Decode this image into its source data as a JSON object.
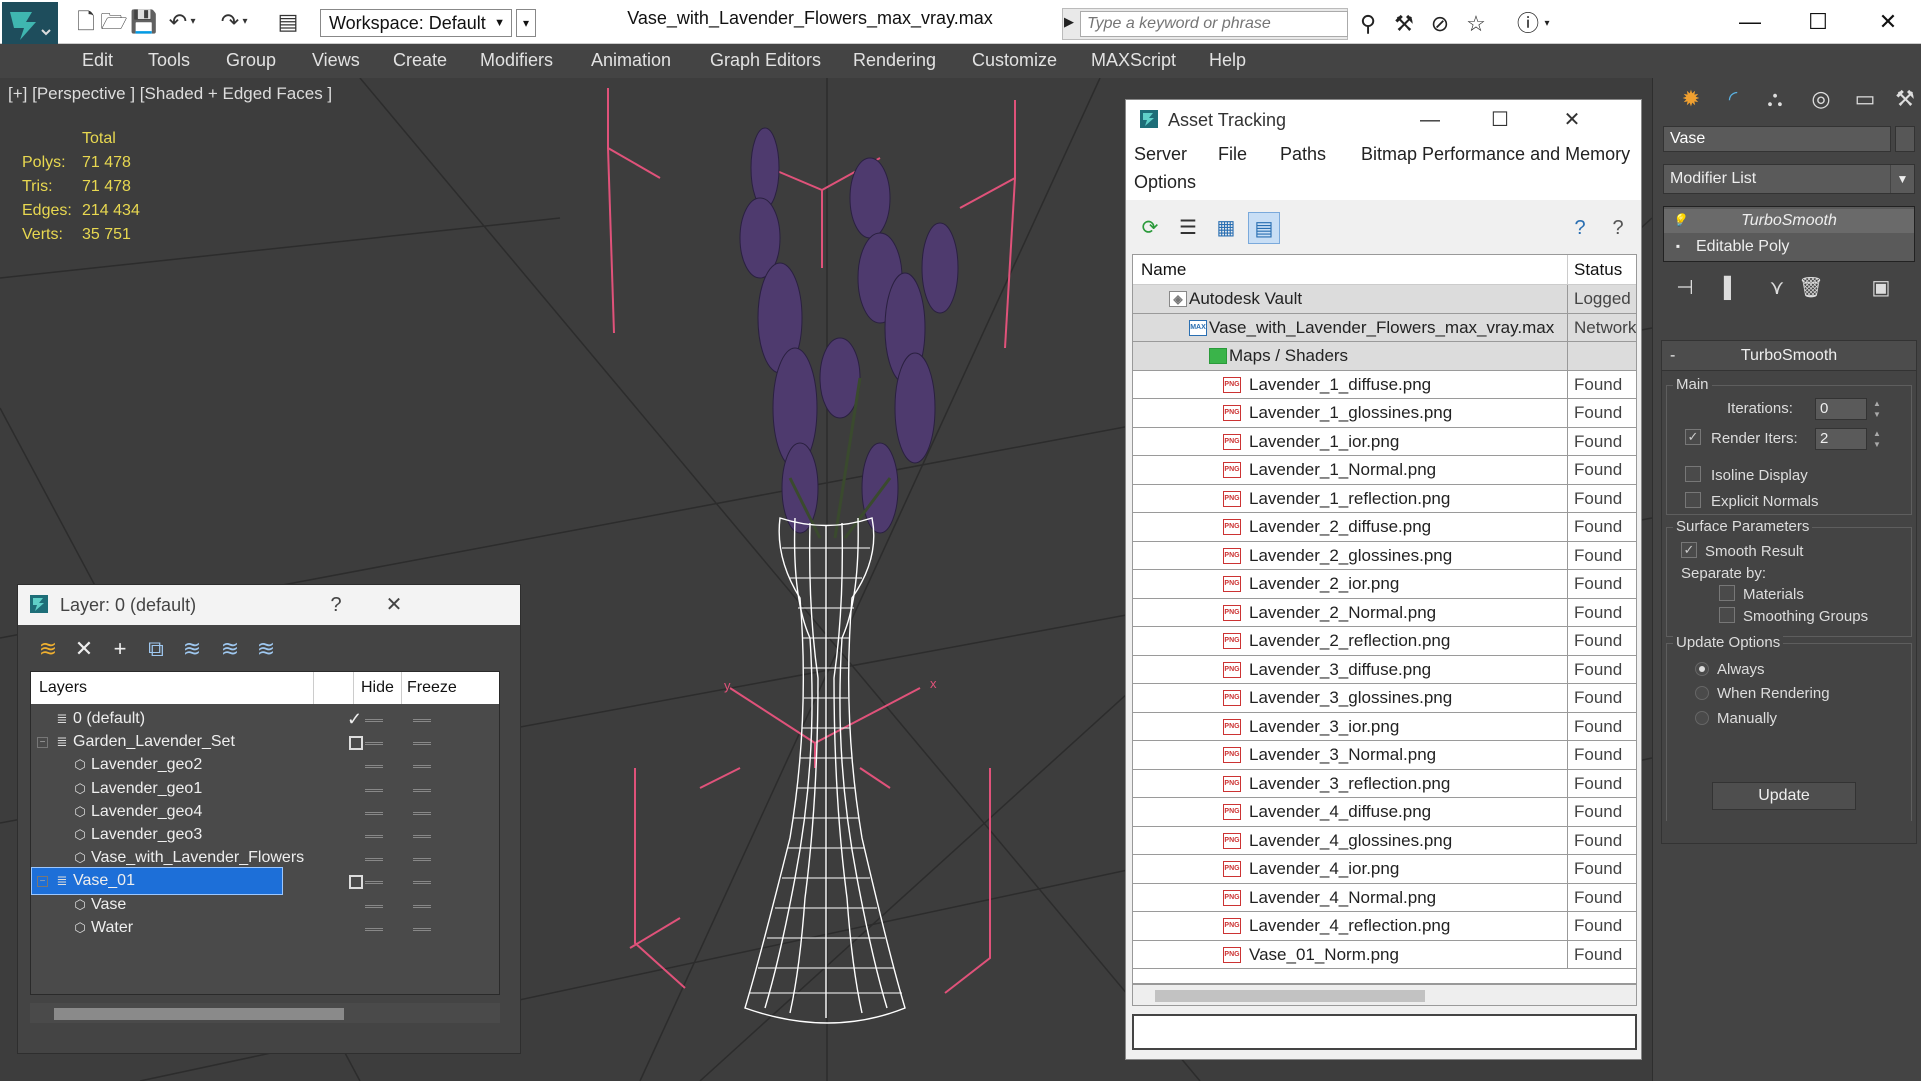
{
  "titlebar": {
    "workspace": "Workspace: Default",
    "file_title": "Vase_with_Lavender_Flowers_max_vray.max",
    "search_placeholder": "Type a keyword or phrase"
  },
  "menu": [
    "Edit",
    "Tools",
    "Group",
    "Views",
    "Create",
    "Modifiers",
    "Animation",
    "Graph Editors",
    "Rendering",
    "Customize",
    "MAXScript",
    "Help"
  ],
  "viewport": {
    "label": "[+] [Perspective ] [Shaded + Edged Faces ]",
    "stats_header": "Total",
    "stats": [
      {
        "label": "Polys:",
        "value": "71 478"
      },
      {
        "label": "Tris:",
        "value": "71 478"
      },
      {
        "label": "Edges:",
        "value": "214 434"
      },
      {
        "label": "Verts:",
        "value": "35 751"
      }
    ],
    "gizmo_x": "x",
    "gizmo_y": "y"
  },
  "command_panel": {
    "object_name": "Vase",
    "modifier_list": "Modifier List",
    "stack": [
      "TurboSmooth",
      "Editable Poly"
    ],
    "rollout_title": "TurboSmooth",
    "main_group": "Main",
    "iterations_label": "Iterations:",
    "iterations_value": "0",
    "render_iters_label": "Render Iters:",
    "render_iters_value": "2",
    "render_iters_checked": true,
    "isoline_display": "Isoline Display",
    "explicit_normals": "Explicit Normals",
    "surface_params_group": "Surface Parameters",
    "smooth_result": "Smooth Result",
    "smooth_result_checked": true,
    "separate_by": "Separate by:",
    "materials": "Materials",
    "smoothing_groups": "Smoothing Groups",
    "update_options_group": "Update Options",
    "update_options": [
      {
        "label": "Always",
        "selected": true
      },
      {
        "label": "When Rendering",
        "selected": false
      },
      {
        "label": "Manually",
        "selected": false
      }
    ],
    "update_button": "Update"
  },
  "asset_tracking": {
    "title": "Asset Tracking",
    "menu": [
      "Server",
      "File",
      "Paths",
      "Bitmap Performance and Memory",
      "Options"
    ],
    "columns": [
      "Name",
      "Status"
    ],
    "rows": [
      {
        "name": "Autodesk Vault",
        "status": "Logged",
        "level": 0,
        "icon": "vault"
      },
      {
        "name": "Vase_with_Lavender_Flowers_max_vray.max",
        "status": "Network",
        "level": 1,
        "icon": "max"
      },
      {
        "name": "Maps / Shaders",
        "status": "",
        "level": 2,
        "icon": "maps"
      },
      {
        "name": "Lavender_1_diffuse.png",
        "status": "Found",
        "level": 3,
        "icon": "png"
      },
      {
        "name": "Lavender_1_glossines.png",
        "status": "Found",
        "level": 3,
        "icon": "png"
      },
      {
        "name": "Lavender_1_ior.png",
        "status": "Found",
        "level": 3,
        "icon": "png"
      },
      {
        "name": "Lavender_1_Normal.png",
        "status": "Found",
        "level": 3,
        "icon": "png"
      },
      {
        "name": "Lavender_1_reflection.png",
        "status": "Found",
        "level": 3,
        "icon": "png"
      },
      {
        "name": "Lavender_2_diffuse.png",
        "status": "Found",
        "level": 3,
        "icon": "png"
      },
      {
        "name": "Lavender_2_glossines.png",
        "status": "Found",
        "level": 3,
        "icon": "png"
      },
      {
        "name": "Lavender_2_ior.png",
        "status": "Found",
        "level": 3,
        "icon": "png"
      },
      {
        "name": "Lavender_2_Normal.png",
        "status": "Found",
        "level": 3,
        "icon": "png"
      },
      {
        "name": "Lavender_2_reflection.png",
        "status": "Found",
        "level": 3,
        "icon": "png"
      },
      {
        "name": "Lavender_3_diffuse.png",
        "status": "Found",
        "level": 3,
        "icon": "png"
      },
      {
        "name": "Lavender_3_glossines.png",
        "status": "Found",
        "level": 3,
        "icon": "png"
      },
      {
        "name": "Lavender_3_ior.png",
        "status": "Found",
        "level": 3,
        "icon": "png"
      },
      {
        "name": "Lavender_3_Normal.png",
        "status": "Found",
        "level": 3,
        "icon": "png"
      },
      {
        "name": "Lavender_3_reflection.png",
        "status": "Found",
        "level": 3,
        "icon": "png"
      },
      {
        "name": "Lavender_4_diffuse.png",
        "status": "Found",
        "level": 3,
        "icon": "png"
      },
      {
        "name": "Lavender_4_glossines.png",
        "status": "Found",
        "level": 3,
        "icon": "png"
      },
      {
        "name": "Lavender_4_ior.png",
        "status": "Found",
        "level": 3,
        "icon": "png"
      },
      {
        "name": "Lavender_4_Normal.png",
        "status": "Found",
        "level": 3,
        "icon": "png"
      },
      {
        "name": "Lavender_4_reflection.png",
        "status": "Found",
        "level": 3,
        "icon": "png"
      },
      {
        "name": "Vase_01_Norm.png",
        "status": "Found",
        "level": 3,
        "icon": "png"
      }
    ]
  },
  "layer_explorer": {
    "title": "Layer: 0 (default)",
    "help": "?",
    "columns": [
      "Layers",
      "Hide",
      "Freeze"
    ],
    "rows": [
      {
        "name": "0 (default)",
        "type": "layer",
        "level": 0,
        "expander": "",
        "current": true,
        "selected": false
      },
      {
        "name": "Garden_Lavender_Set",
        "type": "layer",
        "level": 0,
        "expander": "−",
        "current": false,
        "selected": false,
        "box": true
      },
      {
        "name": "Lavender_geo2",
        "type": "object",
        "level": 1,
        "expander": "",
        "current": false,
        "selected": false
      },
      {
        "name": "Lavender_geo1",
        "type": "object",
        "level": 1,
        "expander": "",
        "current": false,
        "selected": false
      },
      {
        "name": "Lavender_geo4",
        "type": "object",
        "level": 1,
        "expander": "",
        "current": false,
        "selected": false
      },
      {
        "name": "Lavender_geo3",
        "type": "object",
        "level": 1,
        "expander": "",
        "current": false,
        "selected": false
      },
      {
        "name": "Vase_with_Lavender_Flowers",
        "type": "object",
        "level": 1,
        "expander": "",
        "current": false,
        "selected": false
      },
      {
        "name": "Vase_01",
        "type": "layer",
        "level": 0,
        "expander": "−",
        "current": false,
        "selected": true,
        "box": true
      },
      {
        "name": "Vase",
        "type": "object",
        "level": 1,
        "expander": "",
        "current": false,
        "selected": false
      },
      {
        "name": "Water",
        "type": "object",
        "level": 1,
        "expander": "",
        "current": false,
        "selected": false
      }
    ]
  },
  "colors": {
    "viewport_bg": "#3d3d3d",
    "stats_yellow": "#e8d850",
    "bbox_pink": "#e0527a",
    "selection_blue": "#1d6fd8",
    "wire_white": "#ffffff",
    "lavender": "#4e3a6e"
  }
}
